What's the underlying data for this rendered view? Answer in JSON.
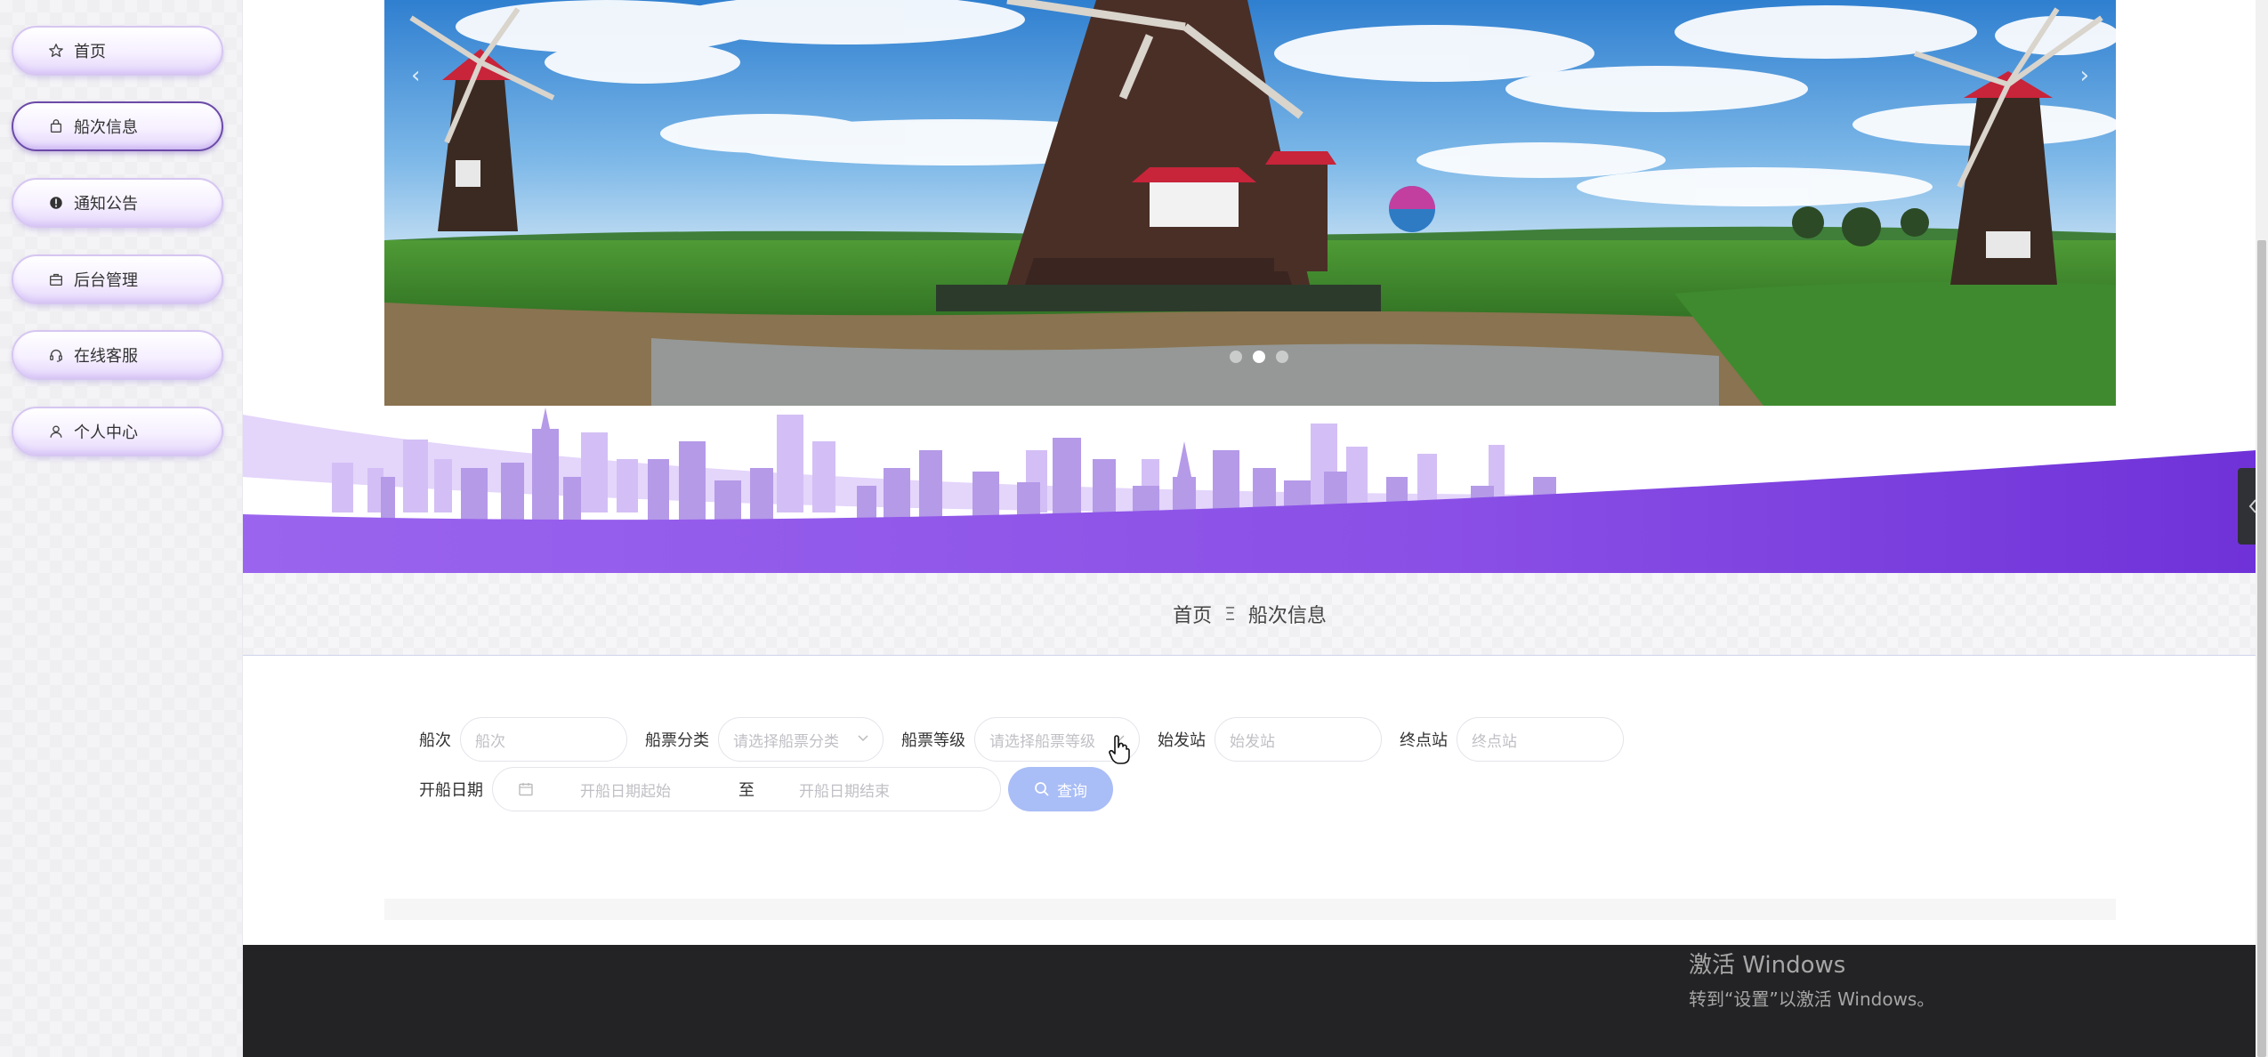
{
  "sidebar": {
    "items": [
      {
        "label": "首页",
        "icon": "star-icon"
      },
      {
        "label": "船次信息",
        "icon": "bag-icon",
        "active": true
      },
      {
        "label": "通知公告",
        "icon": "alert-icon"
      },
      {
        "label": "后台管理",
        "icon": "briefcase-icon"
      },
      {
        "label": "在线客服",
        "icon": "headset-icon"
      },
      {
        "label": "个人中心",
        "icon": "user-icon"
      }
    ]
  },
  "carousel": {
    "slides": 3,
    "active_index": 1
  },
  "breadcrumb": {
    "home": "首页",
    "separator": "Ξ",
    "current": "船次信息"
  },
  "filters": {
    "ship": {
      "label": "船次",
      "placeholder": "船次"
    },
    "category": {
      "label": "船票分类",
      "placeholder": "请选择船票分类"
    },
    "grade": {
      "label": "船票等级",
      "placeholder": "请选择船票等级"
    },
    "origin": {
      "label": "始发站",
      "placeholder": "始发站"
    },
    "destination": {
      "label": "终点站",
      "placeholder": "终点站"
    },
    "date": {
      "label": "开船日期",
      "start_placeholder": "开船日期起始",
      "to": "至",
      "end_placeholder": "开船日期结束"
    },
    "search_label": "查询"
  },
  "watermark": {
    "line1": "激活 Windows",
    "line2": "转到“设置”以激活 Windows。"
  },
  "colors": {
    "accent": "#7b4bd8",
    "search_button": "#a9bdf6",
    "footer": "#232224"
  }
}
